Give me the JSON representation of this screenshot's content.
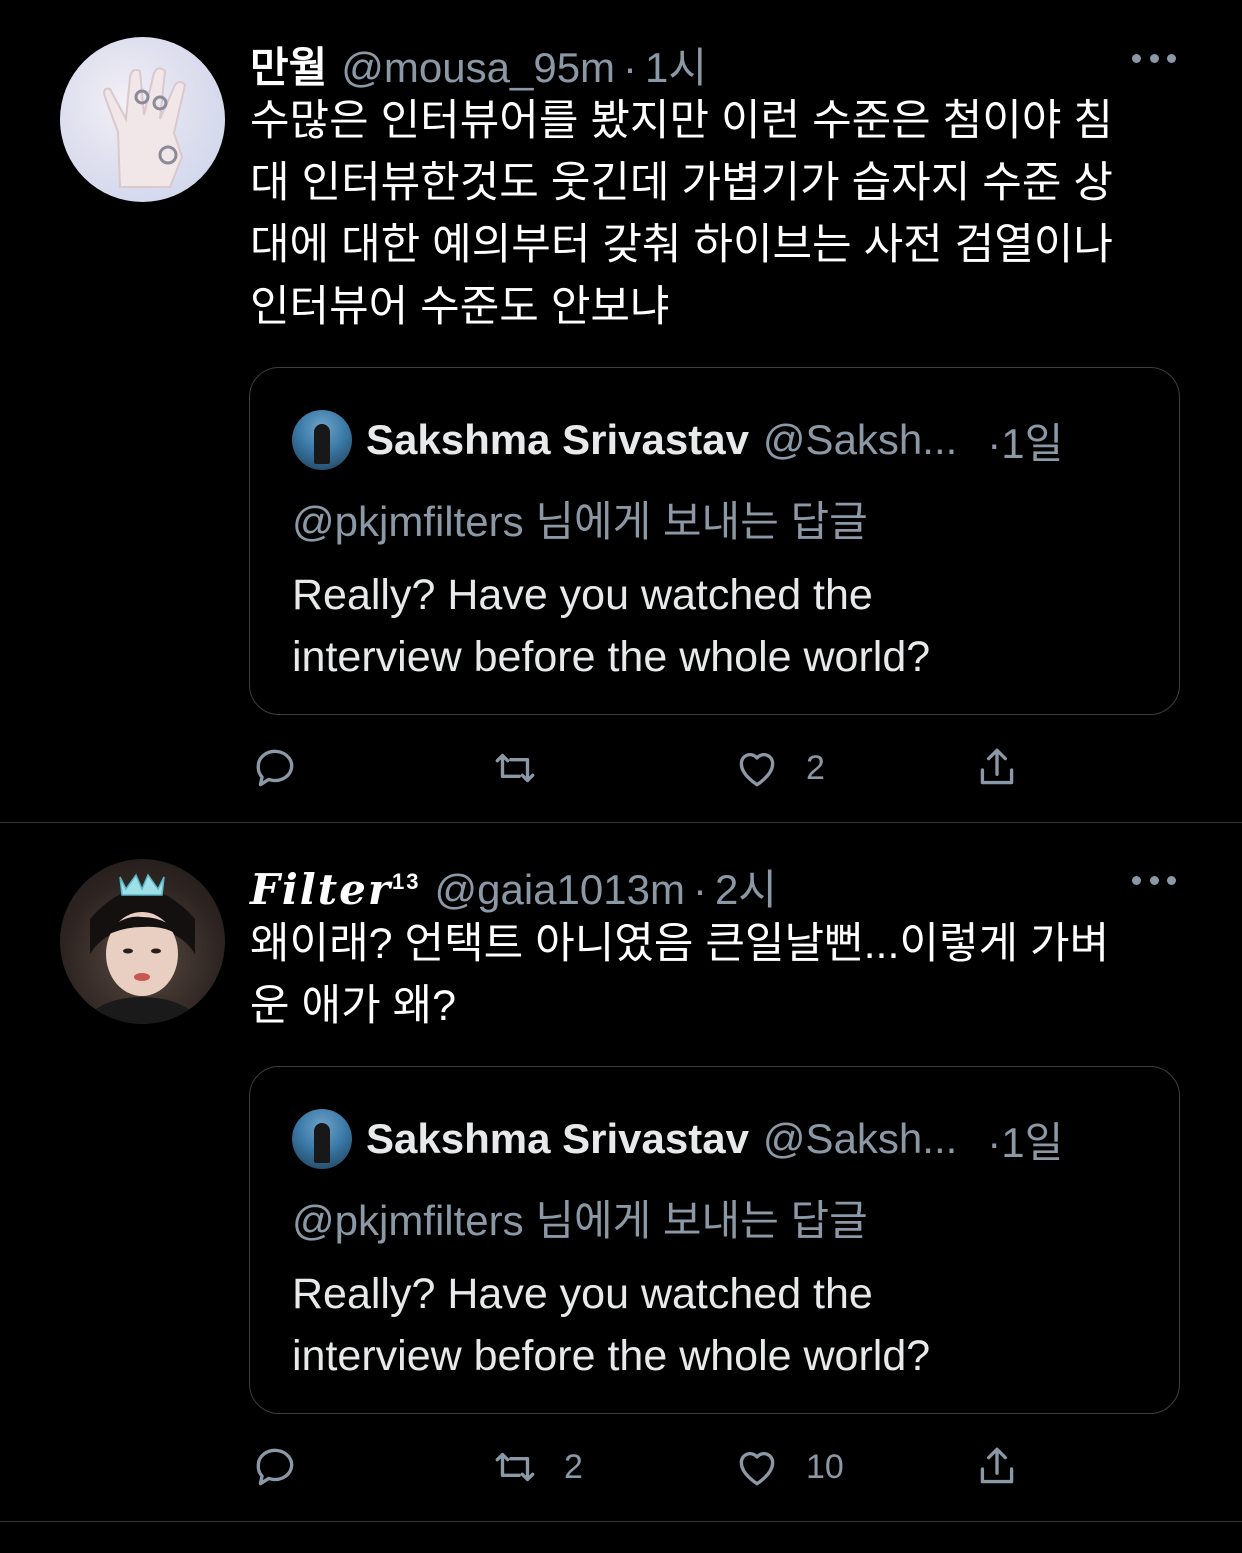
{
  "tweets": [
    {
      "name": "만월",
      "handle": "@mousa_95m",
      "time": "1시",
      "text": "수많은 인터뷰어를 봤지만 이런 수준은 첨이야 침\n대 인터뷰한것도 웃긴데 가볍기가 습자지 수준 상\n대에 대한 예의부터 갖춰 하이브는 사전 검열이나\n인터뷰어 수준도 안보냐",
      "quote": {
        "name": "Sakshma Srivastav",
        "handle": "@Saksh...",
        "time": "1일",
        "reply_to": "@pkjmfilters 님에게 보내는 답글",
        "text": "Really? Have you watched the\ninterview before the whole world?"
      },
      "actions": {
        "replies": "",
        "retweets": "",
        "likes": "2"
      }
    },
    {
      "name": "Filter",
      "name_sup": "13",
      "handle": "@gaia1013m",
      "time": "2시",
      "text": "왜이래? 언택트 아니였음 큰일날뻔...이렇게 가벼\n운 애가 왜?",
      "quote": {
        "name": "Sakshma Srivastav",
        "handle": "@Saksh...",
        "time": "1일",
        "reply_to": "@pkjmfilters 님에게 보내는 답글",
        "text": "Really? Have you watched the\ninterview before the whole world?"
      },
      "actions": {
        "replies": "",
        "retweets": "2",
        "likes": "10"
      }
    }
  ],
  "separator": "·",
  "icons": {
    "reply": "reply-icon",
    "retweet": "retweet-icon",
    "like": "heart-icon",
    "share": "share-icon",
    "more": "more-icon"
  },
  "colors": {
    "background": "#000000",
    "text": "#ffffff",
    "secondary": "#8b98a5",
    "border": "#3a3f44"
  }
}
